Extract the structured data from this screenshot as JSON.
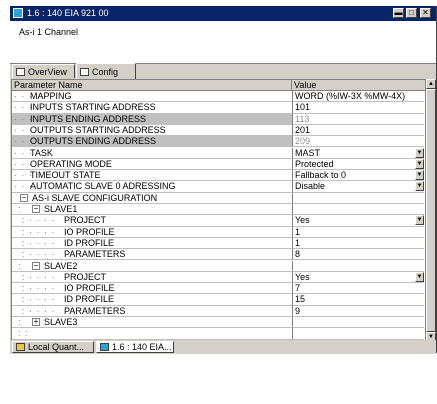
{
  "window": {
    "title": "1.6 : 140 EIA 921 00",
    "description": "As-i 1 Channel",
    "minimize": "▬",
    "maximize": "□",
    "close": "✕"
  },
  "tabs": [
    {
      "label": "OverView",
      "active": false
    },
    {
      "label": "Config",
      "active": true
    }
  ],
  "columns": {
    "name": "Parameter Name",
    "value": "Value"
  },
  "rows": [
    {
      "dots": "· · ·",
      "label": "MAPPING",
      "value": "WORD (%IW-3X %MW-4X)"
    },
    {
      "dots": "· · ·",
      "label": "INPUTS STARTING ADDRESS",
      "value": "101"
    },
    {
      "dots": "· · ·",
      "label": "INPUTS ENDING ADDRESS",
      "value": "113"
    },
    {
      "dots": "· · ·",
      "label": "OUTPUTS STARTING ADDRESS",
      "value": "201"
    },
    {
      "dots": "· · ·",
      "label": "OUTPUTS ENDING ADDRESS",
      "value": "209"
    },
    {
      "dots": "· · ·",
      "label": "TASK",
      "value": "MAST"
    },
    {
      "dots": "· · ·",
      "label": "OPERATING MODE",
      "value": "Protected"
    },
    {
      "dots": "· · ·",
      "label": "TIMEOUT STATE",
      "value": "Fallback to 0"
    },
    {
      "dots": "· · ·",
      "label": "AUTOMATIC SLAVE 0 ADRESSING",
      "value": "Disable"
    },
    {
      "dots": "",
      "label": "AS-i SLAVE CONFIGURATION",
      "value": "",
      "toggle": "−"
    },
    {
      "dots": ":",
      "label": "SLAVE1",
      "value": "",
      "toggle": "−"
    },
    {
      "dots": ": · · · ·",
      "label": "PROJECT",
      "value": "Yes"
    },
    {
      "dots": ": · · · ·",
      "label": "IO PROFILE",
      "value": "1"
    },
    {
      "dots": ": · · · ·",
      "label": "ID PROFILE",
      "value": "1"
    },
    {
      "dots": ": · · · ·",
      "label": "PARAMETERS",
      "value": "8"
    },
    {
      "dots": ":",
      "label": "SLAVE2",
      "value": "",
      "toggle": "−"
    },
    {
      "dots": ": · · · ·",
      "label": "PROJECT",
      "value": "Yes"
    },
    {
      "dots": ": · · · ·",
      "label": "IO PROFILE",
      "value": "7"
    },
    {
      "dots": ": · · · ·",
      "label": "ID PROFILE",
      "value": "15"
    },
    {
      "dots": ": · · · ·",
      "label": "PARAMETERS",
      "value": "9"
    },
    {
      "dots": ":",
      "label": "SLAVE3",
      "value": "",
      "toggle": "+"
    },
    {
      "dots": ": :",
      "label": "",
      "value": ""
    }
  ],
  "taskbar": [
    {
      "label": "Local Quant...",
      "active": false
    },
    {
      "label": "1.6 : 140 EIA...",
      "active": true
    }
  ],
  "scroll": {
    "up": "▲",
    "down": "▼"
  },
  "dropdown_glyph": "▼"
}
